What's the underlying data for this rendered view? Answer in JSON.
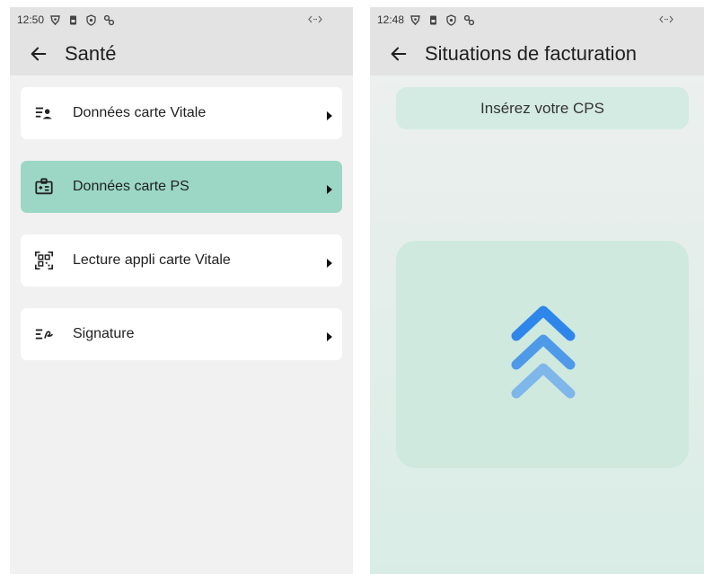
{
  "left_screen": {
    "status": {
      "time": "12:50"
    },
    "appbar": {
      "title": "Santé"
    },
    "menu": [
      {
        "label": "Données carte Vitale",
        "icon": "id-card-person-icon",
        "active": false
      },
      {
        "label": "Données carte PS",
        "icon": "badge-card-icon",
        "active": true
      },
      {
        "label": "Lecture appli carte Vitale",
        "icon": "qr-code-icon",
        "active": false
      },
      {
        "label": "Signature",
        "icon": "signature-icon",
        "active": false
      }
    ]
  },
  "right_screen": {
    "status": {
      "time": "12:48"
    },
    "appbar": {
      "title": "Situations de facturation"
    },
    "banner": {
      "text": "Insérez votre CPS"
    },
    "insert_icon": "triple-chevron-up-icon"
  },
  "colors": {
    "active_item": "#9bd7c4",
    "appbar": "#e3e3e3",
    "banner": "#d4ebe3",
    "panel": "#cfe9df",
    "chevron_dark": "#2f86ea",
    "chevron_mid": "#4e9ae8",
    "chevron_light": "#7fb7ea"
  }
}
